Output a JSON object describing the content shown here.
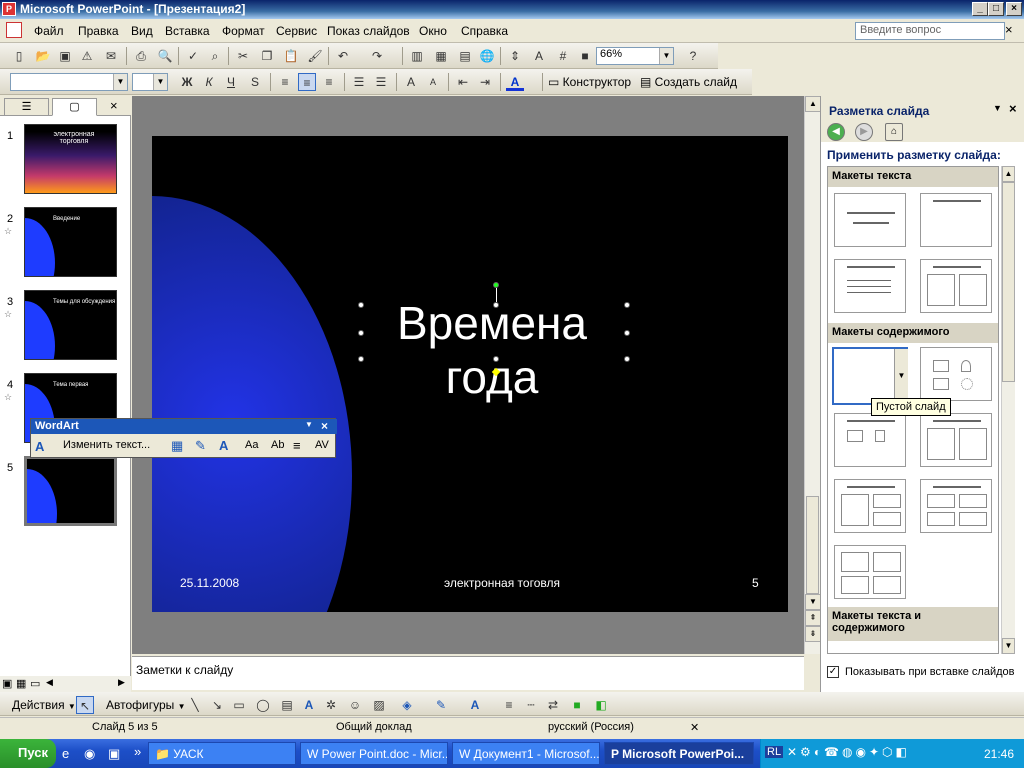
{
  "window": {
    "title": "Microsoft PowerPoint - [Презентация2]",
    "app_icon": "P",
    "buttons": {
      "minimize": "_",
      "maximize": "□",
      "close": "×"
    }
  },
  "menu": {
    "items": [
      "Файл",
      "Правка",
      "Вид",
      "Вставка",
      "Формат",
      "Сервис",
      "Показ слайдов",
      "Окно",
      "Справка"
    ],
    "help_placeholder": "Введите вопрос",
    "close": "×"
  },
  "toolbar": {
    "zoom": "66%",
    "designer_label": "Конструктор",
    "new_slide_label": "Создать слайд",
    "bold": "Ж",
    "italic": "К",
    "underline": "Ч",
    "shadow": "S",
    "font_color": "A"
  },
  "left_pane": {
    "close": "×",
    "slides": [
      {
        "num": "1",
        "title": "электронная торговля"
      },
      {
        "num": "2",
        "title": "Введение"
      },
      {
        "num": "3",
        "title": "Темы для обсуждения"
      },
      {
        "num": "4",
        "title": "Тема первая"
      },
      {
        "num": "5",
        "title": ""
      }
    ]
  },
  "slide": {
    "title": "Времена года",
    "date": "25.11.2008",
    "footer": "электронная тоговля",
    "number": "5"
  },
  "notes": {
    "placeholder": "Заметки к слайду"
  },
  "task_pane": {
    "title": "Разметка слайда",
    "close": "×",
    "apply_label": "Применить разметку слайда:",
    "sections": [
      "Макеты текста",
      "Макеты содержимого",
      "Макеты текста и содержимого"
    ],
    "tooltip": "Пустой слайд",
    "show_checkbox": "Показывать при вставке слайдов",
    "show_checked": true
  },
  "wordart": {
    "title": "WordArt",
    "edit_text": "Изменить текст...",
    "close": "×"
  },
  "drawing": {
    "actions": "Действия",
    "autoshapes": "Автофигуры"
  },
  "status": {
    "slide": "Слайд 5 из 5",
    "design": "Общий доклад",
    "language": "русский (Россия)"
  },
  "taskbar": {
    "start": "Пуск",
    "items": [
      "УАСК",
      "Power Point.doc - Micr...",
      "Документ1 - Microsof...",
      "Microsoft PowerPoi..."
    ],
    "tray_lang": "RL",
    "clock": "21:46"
  }
}
